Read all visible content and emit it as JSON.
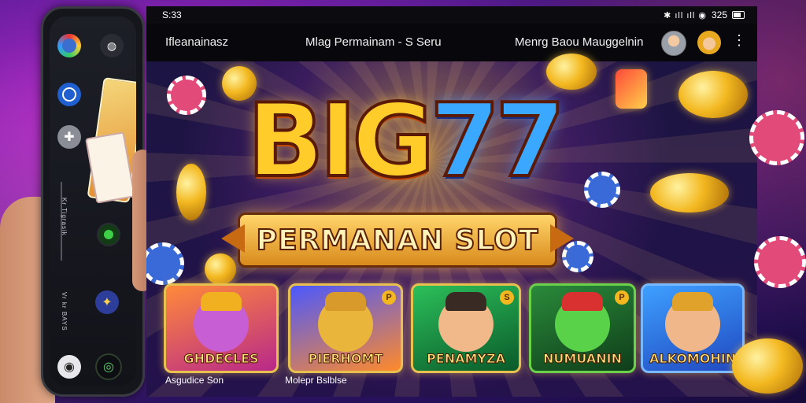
{
  "phone": {
    "icons": [
      "avatar-icon",
      "apple-icon",
      "ring-icon",
      "grey-app-icon",
      "green-app-icon",
      "blue-app-icon",
      "home-icon",
      "game-icon"
    ],
    "vertical_text_1": "Kr Tigrasik",
    "vertical_text_2": "Vr kr BAYS"
  },
  "statusbar": {
    "time": "S:33",
    "icons": "✱ ıll ıll ◉",
    "battery": "325"
  },
  "topbar": {
    "left": "Ifleanainasz",
    "center": "Mlag Permainam - S Seru",
    "right": "Menrg Baou Mauggelnin",
    "more": "⋮"
  },
  "logo": {
    "big": "BIG",
    "num": "77",
    "banner": "PERMANAN SLOT"
  },
  "games": [
    {
      "title": "GHDECLES",
      "badge": ""
    },
    {
      "title": "PIERHOMT",
      "badge": "P"
    },
    {
      "title": "PENAMYZA",
      "badge": "S"
    },
    {
      "title": "NUMUANIN",
      "badge": "P"
    },
    {
      "title": "ALKOMOHIN",
      "badge": ""
    }
  ],
  "captions": {
    "first": "Asgudice Son",
    "second": "Molepr Bslblse"
  }
}
